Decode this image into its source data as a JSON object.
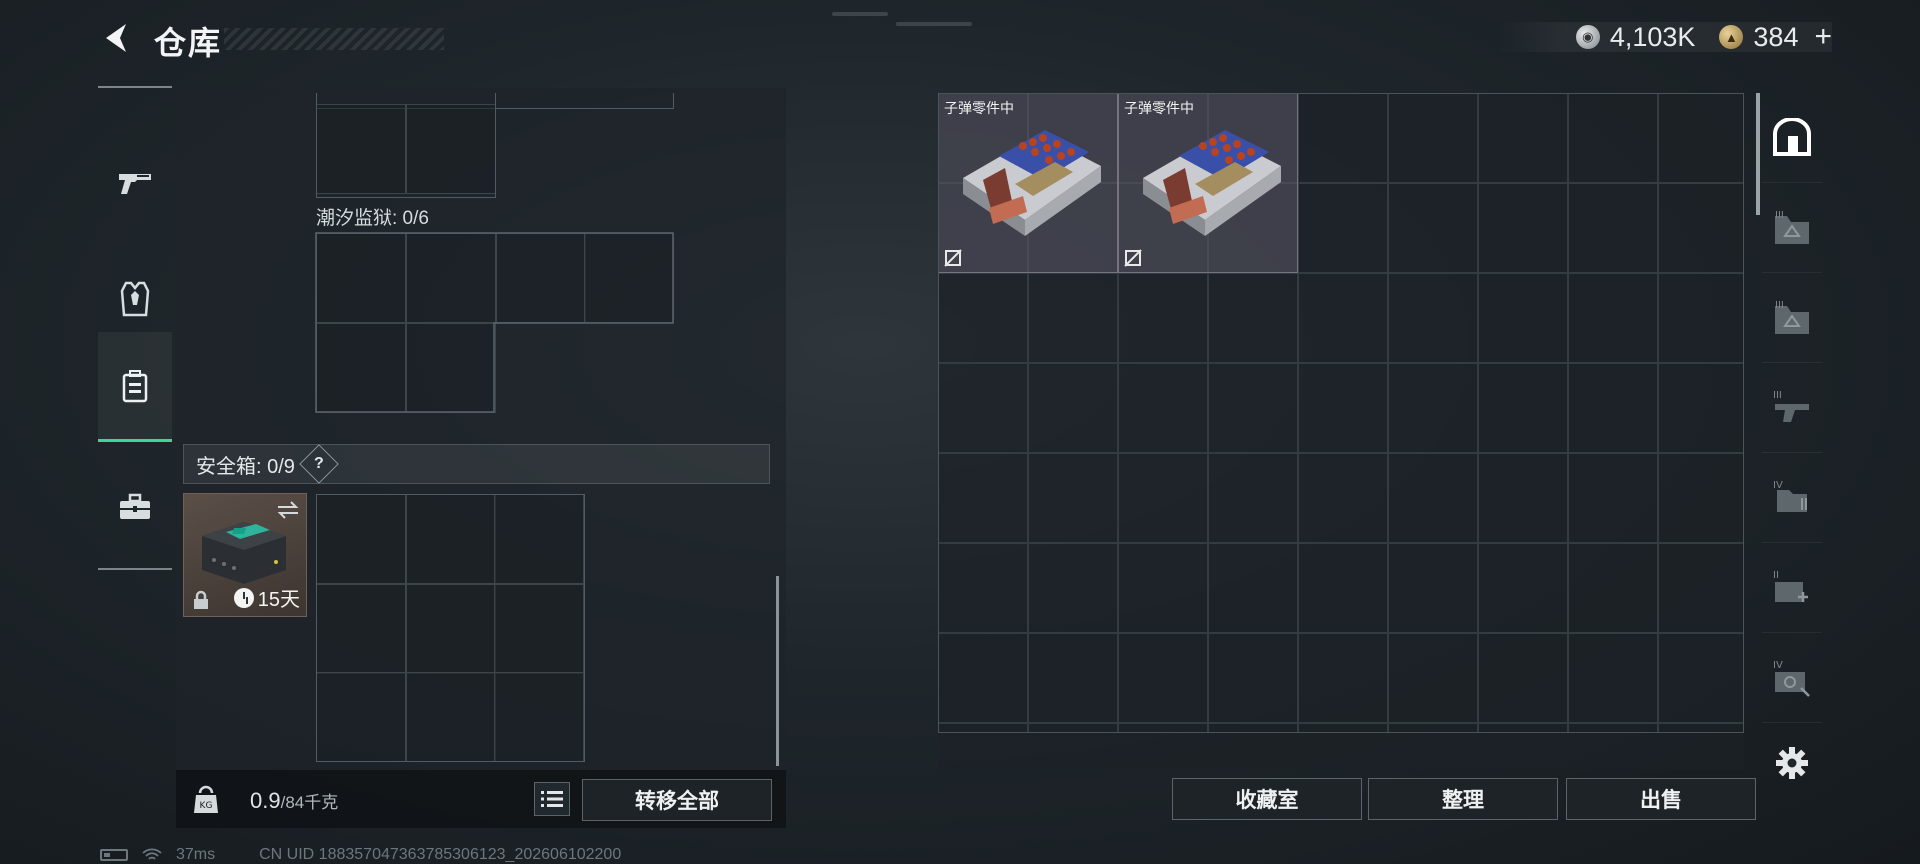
{
  "header": {
    "title": "仓库",
    "currency": [
      {
        "icon": "silver-coin-icon",
        "value": "4,103K"
      },
      {
        "icon": "gold-coin-icon",
        "value": "384"
      }
    ],
    "plus": "+"
  },
  "sidebar": {
    "items": [
      {
        "icon": "gun-icon"
      },
      {
        "icon": "armor-vest-icon"
      },
      {
        "icon": "backpack-icon",
        "active": true
      },
      {
        "icon": "briefcase-icon"
      }
    ]
  },
  "containers": {
    "tide_prison_label": "潮汐监狱: 0/6",
    "safebox_label": "安全箱: 0/9",
    "help_symbol": "?",
    "safebox_days": "15天"
  },
  "weight": {
    "current": "0.9",
    "max": "/84千克"
  },
  "buttons": {
    "transfer_all": "转移全部",
    "collection_room": "收藏室",
    "organize": "整理",
    "sell": "出售"
  },
  "stash": {
    "items": [
      {
        "name": "子弹零件中"
      },
      {
        "name": "子弹零件中"
      }
    ]
  },
  "status": {
    "ping": "37ms",
    "uid": "CN UID 1883570473637853061​23_202606102200"
  },
  "colors": {
    "accent_green": "#3fd49a",
    "item_purple_bg": "#5a5866",
    "safebox_brown": "#5b4f48"
  }
}
